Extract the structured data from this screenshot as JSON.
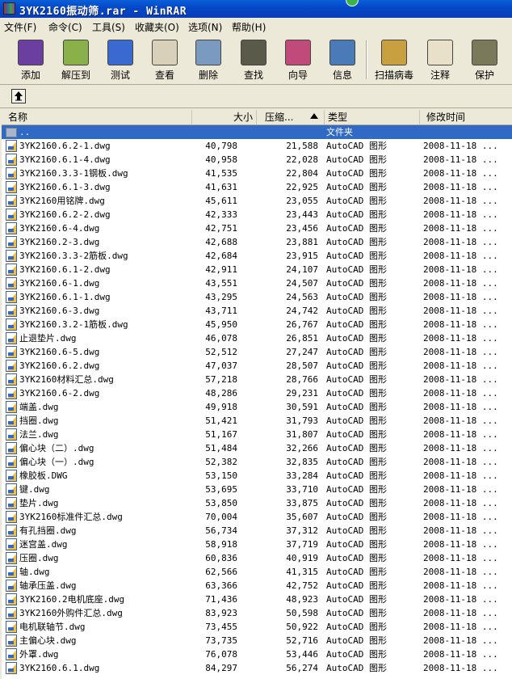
{
  "window": {
    "title": "3YK2160振动筛.rar - WinRAR"
  },
  "menu": [
    "文件(F)",
    "命令(C)",
    "工具(S)",
    "收藏夹(O)",
    "选项(N)",
    "帮助(H)"
  ],
  "toolbar": [
    {
      "label": "添加",
      "icon": "add-books-icon",
      "color": "#6a3fa0"
    },
    {
      "label": "解压到",
      "icon": "extract-icon",
      "color": "#8ab04a"
    },
    {
      "label": "测试",
      "icon": "test-icon",
      "color": "#3a6ad0"
    },
    {
      "label": "查看",
      "icon": "view-glasses-icon",
      "color": "#d8d0b8"
    },
    {
      "label": "删除",
      "icon": "delete-icon",
      "color": "#7a9ac0"
    },
    {
      "label": "查找",
      "icon": "find-binoculars-icon",
      "color": "#5a5a4a"
    },
    {
      "label": "向导",
      "icon": "wizard-icon",
      "color": "#c04a7a"
    },
    {
      "label": "信息",
      "icon": "info-icon",
      "color": "#4a7ab8"
    },
    {
      "label": "扫描病毒",
      "icon": "virus-scan-icon",
      "color": "#c8a040"
    },
    {
      "label": "注释",
      "icon": "comment-icon",
      "color": "#e8e0c8"
    },
    {
      "label": "保护",
      "icon": "protect-shield-icon",
      "color": "#7a7a5a"
    }
  ],
  "columns": {
    "name": "名称",
    "size": "大小",
    "packed": "压缩...",
    "type": "类型",
    "modified": "修改时间"
  },
  "parent_row": {
    "name": "..",
    "type": "文件夹"
  },
  "files": [
    {
      "name": "3YK2160.6.2-1.dwg",
      "size": "40,798",
      "packed": "21,588",
      "type": "AutoCAD 图形",
      "modified": "2008-11-18 ..."
    },
    {
      "name": "3YK2160.6.1-4.dwg",
      "size": "40,958",
      "packed": "22,028",
      "type": "AutoCAD 图形",
      "modified": "2008-11-18 ..."
    },
    {
      "name": "3YK2160.3.3-1钢板.dwg",
      "size": "41,535",
      "packed": "22,804",
      "type": "AutoCAD 图形",
      "modified": "2008-11-18 ..."
    },
    {
      "name": "3YK2160.6.1-3.dwg",
      "size": "41,631",
      "packed": "22,925",
      "type": "AutoCAD 图形",
      "modified": "2008-11-18 ..."
    },
    {
      "name": "3YK2160用铭牌.dwg",
      "size": "45,611",
      "packed": "23,055",
      "type": "AutoCAD 图形",
      "modified": "2008-11-18 ..."
    },
    {
      "name": "3YK2160.6.2-2.dwg",
      "size": "42,333",
      "packed": "23,443",
      "type": "AutoCAD 图形",
      "modified": "2008-11-18 ..."
    },
    {
      "name": "3YK2160.6-4.dwg",
      "size": "42,751",
      "packed": "23,456",
      "type": "AutoCAD 图形",
      "modified": "2008-11-18 ..."
    },
    {
      "name": "3YK2160.2-3.dwg",
      "size": "42,688",
      "packed": "23,881",
      "type": "AutoCAD 图形",
      "modified": "2008-11-18 ..."
    },
    {
      "name": "3YK2160.3.3-2筋板.dwg",
      "size": "42,684",
      "packed": "23,915",
      "type": "AutoCAD 图形",
      "modified": "2008-11-18 ..."
    },
    {
      "name": "3YK2160.6.1-2.dwg",
      "size": "42,911",
      "packed": "24,107",
      "type": "AutoCAD 图形",
      "modified": "2008-11-18 ..."
    },
    {
      "name": "3YK2160.6-1.dwg",
      "size": "43,551",
      "packed": "24,507",
      "type": "AutoCAD 图形",
      "modified": "2008-11-18 ..."
    },
    {
      "name": "3YK2160.6.1-1.dwg",
      "size": "43,295",
      "packed": "24,563",
      "type": "AutoCAD 图形",
      "modified": "2008-11-18 ..."
    },
    {
      "name": "3YK2160.6-3.dwg",
      "size": "43,711",
      "packed": "24,742",
      "type": "AutoCAD 图形",
      "modified": "2008-11-18 ..."
    },
    {
      "name": "3YK2160.3.2-1筋板.dwg",
      "size": "45,950",
      "packed": "26,767",
      "type": "AutoCAD 图形",
      "modified": "2008-11-18 ..."
    },
    {
      "name": "止退垫片.dwg",
      "size": "46,078",
      "packed": "26,851",
      "type": "AutoCAD 图形",
      "modified": "2008-11-18 ..."
    },
    {
      "name": "3YK2160.6-5.dwg",
      "size": "52,512",
      "packed": "27,247",
      "type": "AutoCAD 图形",
      "modified": "2008-11-18 ..."
    },
    {
      "name": "3YK2160.6.2.dwg",
      "size": "47,037",
      "packed": "28,507",
      "type": "AutoCAD 图形",
      "modified": "2008-11-18 ..."
    },
    {
      "name": "3YK2160材料汇总.dwg",
      "size": "57,218",
      "packed": "28,766",
      "type": "AutoCAD 图形",
      "modified": "2008-11-18 ..."
    },
    {
      "name": "3YK2160.6-2.dwg",
      "size": "48,286",
      "packed": "29,231",
      "type": "AutoCAD 图形",
      "modified": "2008-11-18 ..."
    },
    {
      "name": "端盖.dwg",
      "size": "49,918",
      "packed": "30,591",
      "type": "AutoCAD 图形",
      "modified": "2008-11-18 ..."
    },
    {
      "name": "挡圈.dwg",
      "size": "51,421",
      "packed": "31,793",
      "type": "AutoCAD 图形",
      "modified": "2008-11-18 ..."
    },
    {
      "name": "法兰.dwg",
      "size": "51,167",
      "packed": "31,807",
      "type": "AutoCAD 图形",
      "modified": "2008-11-18 ..."
    },
    {
      "name": "偏心块（二）.dwg",
      "size": "51,484",
      "packed": "32,266",
      "type": "AutoCAD 图形",
      "modified": "2008-11-18 ..."
    },
    {
      "name": "偏心块（一）.dwg",
      "size": "52,382",
      "packed": "32,835",
      "type": "AutoCAD 图形",
      "modified": "2008-11-18 ..."
    },
    {
      "name": "橡胶板.DWG",
      "size": "53,150",
      "packed": "33,284",
      "type": "AutoCAD 图形",
      "modified": "2008-11-18 ..."
    },
    {
      "name": "键.dwg",
      "size": "53,695",
      "packed": "33,710",
      "type": "AutoCAD 图形",
      "modified": "2008-11-18 ..."
    },
    {
      "name": "垫片.dwg",
      "size": "53,850",
      "packed": "33,875",
      "type": "AutoCAD 图形",
      "modified": "2008-11-18 ..."
    },
    {
      "name": "3YK2160标准件汇总.dwg",
      "size": "70,004",
      "packed": "35,607",
      "type": "AutoCAD 图形",
      "modified": "2008-11-18 ..."
    },
    {
      "name": "有孔挡圈.dwg",
      "size": "56,734",
      "packed": "37,312",
      "type": "AutoCAD 图形",
      "modified": "2008-11-18 ..."
    },
    {
      "name": "迷宫盖.dwg",
      "size": "58,918",
      "packed": "37,719",
      "type": "AutoCAD 图形",
      "modified": "2008-11-18 ..."
    },
    {
      "name": "压圈.dwg",
      "size": "60,836",
      "packed": "40,919",
      "type": "AutoCAD 图形",
      "modified": "2008-11-18 ..."
    },
    {
      "name": "轴.dwg",
      "size": "62,566",
      "packed": "41,315",
      "type": "AutoCAD 图形",
      "modified": "2008-11-18 ..."
    },
    {
      "name": "轴承压盖.dwg",
      "size": "63,366",
      "packed": "42,752",
      "type": "AutoCAD 图形",
      "modified": "2008-11-18 ..."
    },
    {
      "name": "3YK2160.2电机底座.dwg",
      "size": "71,436",
      "packed": "48,923",
      "type": "AutoCAD 图形",
      "modified": "2008-11-18 ..."
    },
    {
      "name": "3YK2160外购件汇总.dwg",
      "size": "83,923",
      "packed": "50,598",
      "type": "AutoCAD 图形",
      "modified": "2008-11-18 ..."
    },
    {
      "name": "电机联轴节.dwg",
      "size": "73,455",
      "packed": "50,922",
      "type": "AutoCAD 图形",
      "modified": "2008-11-18 ..."
    },
    {
      "name": "主偏心块.dwg",
      "size": "73,735",
      "packed": "52,716",
      "type": "AutoCAD 图形",
      "modified": "2008-11-18 ..."
    },
    {
      "name": "外罩.dwg",
      "size": "76,078",
      "packed": "53,446",
      "type": "AutoCAD 图形",
      "modified": "2008-11-18 ..."
    },
    {
      "name": "3YK2160.6.1.dwg",
      "size": "84,297",
      "packed": "56,274",
      "type": "AutoCAD 图形",
      "modified": "2008-11-18 ..."
    }
  ]
}
